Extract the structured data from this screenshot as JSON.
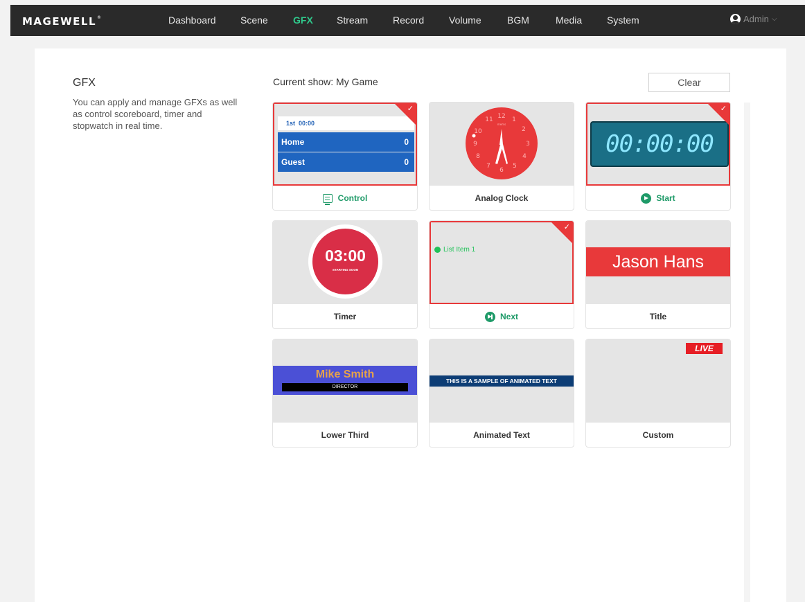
{
  "brand": {
    "logo": "MAGEWELL",
    "reg": "®"
  },
  "nav": [
    {
      "label": "Dashboard",
      "active": false
    },
    {
      "label": "Scene",
      "active": false
    },
    {
      "label": "GFX",
      "active": true
    },
    {
      "label": "Stream",
      "active": false
    },
    {
      "label": "Record",
      "active": false
    },
    {
      "label": "Volume",
      "active": false
    },
    {
      "label": "BGM",
      "active": false
    },
    {
      "label": "Media",
      "active": false
    },
    {
      "label": "System",
      "active": false
    }
  ],
  "user": {
    "name": "Admin",
    "icon": "user-icon"
  },
  "sidebar": {
    "title": "GFX",
    "description": "You can apply and manage GFXs as well as control scoreboard, timer and stopwatch in real time."
  },
  "show": {
    "label": "Current show: My Game",
    "clear_label": "Clear"
  },
  "colors": {
    "accent": "#2fc98c",
    "selected": "#e8393a",
    "action": "#1e9a68"
  },
  "cards": [
    {
      "name": "Scoreboard",
      "label": "Control",
      "selected": true,
      "action": true,
      "icon": "control-icon",
      "preview": {
        "period": "1st",
        "time": "00:00",
        "home": "Home",
        "home_score": "0",
        "guest": "Guest",
        "guest_score": "0"
      }
    },
    {
      "name": "Analog Clock",
      "label": "Analog Clock",
      "selected": false,
      "action": false,
      "preview": {
        "numbers": [
          "12",
          "1",
          "2",
          "3",
          "4",
          "5",
          "6",
          "7",
          "8",
          "9",
          "10",
          "11"
        ],
        "brand": "mems"
      }
    },
    {
      "name": "Stopwatch",
      "label": "Start",
      "selected": true,
      "action": true,
      "icon": "play-icon",
      "preview": {
        "time": "00:00:00"
      }
    },
    {
      "name": "Timer",
      "label": "Timer",
      "selected": false,
      "action": false,
      "preview": {
        "time": "03:00",
        "sub": "STARTING SOON"
      }
    },
    {
      "name": "List",
      "label": "Next",
      "selected": true,
      "action": true,
      "icon": "next-icon",
      "preview": {
        "item": "List Item 1"
      }
    },
    {
      "name": "Title",
      "label": "Title",
      "selected": false,
      "action": false,
      "preview": {
        "text": "Jason Hans"
      }
    },
    {
      "name": "Lower Third",
      "label": "Lower Third",
      "selected": false,
      "action": false,
      "preview": {
        "name": "Mike Smith",
        "role": "DIRECTOR"
      }
    },
    {
      "name": "Animated Text",
      "label": "Animated Text",
      "selected": false,
      "action": false,
      "preview": {
        "text": "THIS IS A SAMPLE OF ANIMATED TEXT"
      }
    },
    {
      "name": "Custom",
      "label": "Custom",
      "selected": false,
      "action": false,
      "preview": {
        "badge": "LIVE"
      }
    }
  ]
}
